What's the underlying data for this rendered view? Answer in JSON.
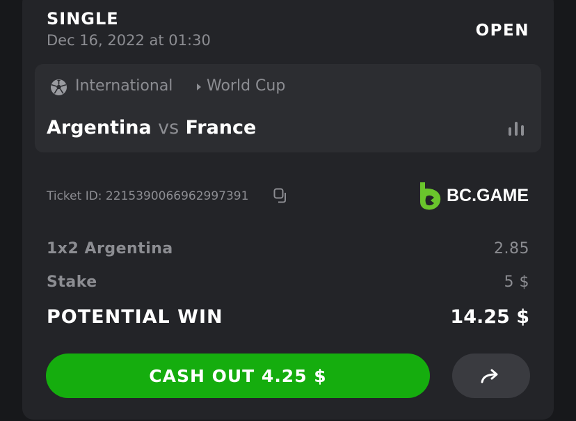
{
  "bet": {
    "type": "SINGLE",
    "date": "Dec 16, 2022 at 01:30",
    "status": "OPEN"
  },
  "event": {
    "sport_icon": "soccer-ball-icon",
    "category": "International",
    "tournament": "World Cup",
    "home_team": "Argentina",
    "vs": "vs",
    "away_team": "France"
  },
  "ticket": {
    "label": "Ticket ID: 2215390066962997391",
    "brand": "BC.GAME",
    "brand_color": "#6ac52c"
  },
  "selection": {
    "market": "1x2 Argentina",
    "odds": "2.85"
  },
  "stake": {
    "label": "Stake",
    "value": "5 $"
  },
  "potential_win": {
    "label": "POTENTIAL WIN",
    "value": "14.25 $"
  },
  "actions": {
    "cashout_label": "CASH OUT 4.25 $",
    "cashout_color": "#15ad0e",
    "share_icon": "share-arrow-icon"
  }
}
